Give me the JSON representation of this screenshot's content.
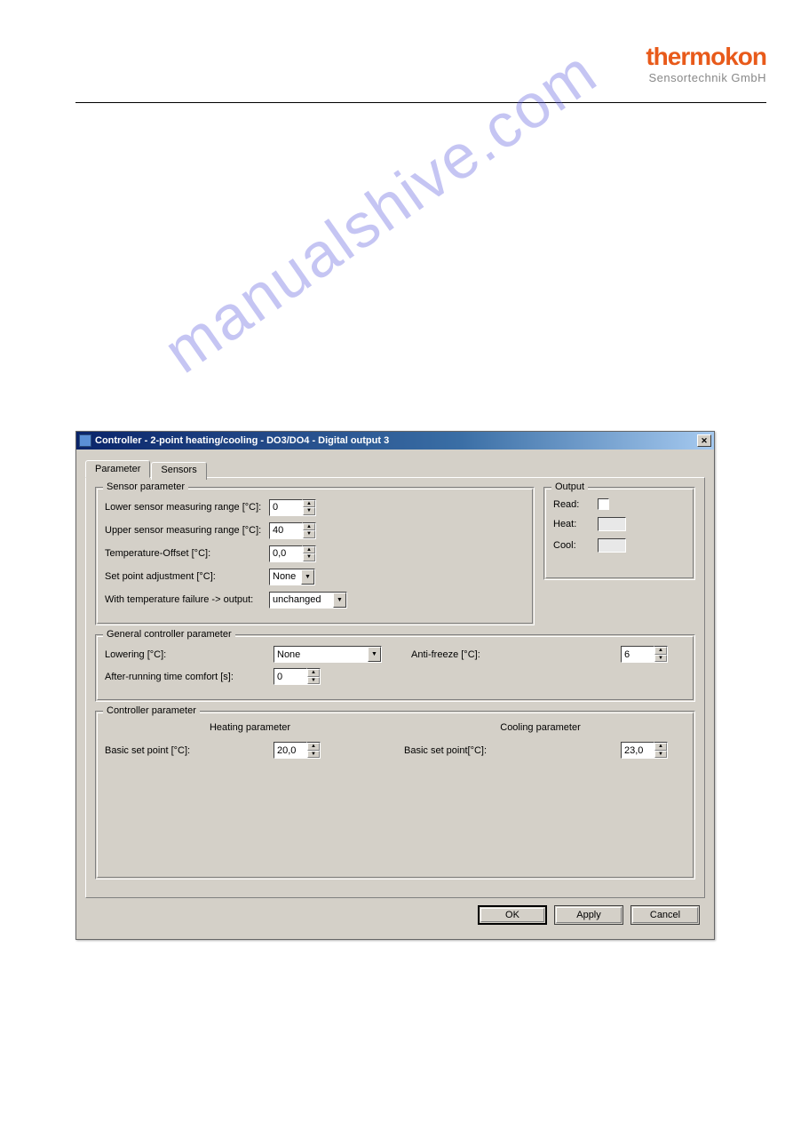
{
  "logo": {
    "line1": "thermokon",
    "line2": "Sensortechnik GmbH"
  },
  "watermark": "manualshive.com",
  "window": {
    "title": "Controller - 2-point heating/cooling - DO3/DO4 - Digital output 3"
  },
  "tabs": {
    "parameter": "Parameter",
    "sensors": "Sensors"
  },
  "sensorParameter": {
    "legend": "Sensor parameter",
    "lowerLabel": "Lower sensor measuring range [°C]:",
    "lowerValue": "0",
    "upperLabel": "Upper sensor measuring range [°C]:",
    "upperValue": "40",
    "offsetLabel": "Temperature-Offset [°C]:",
    "offsetValue": "0,0",
    "setpointLabel": "Set point adjustment [°C]:",
    "setpointValue": "None",
    "failureLabel": "With temperature failure -> output:",
    "failureValue": "unchanged"
  },
  "output": {
    "legend": "Output",
    "readLabel": "Read:",
    "heatLabel": "Heat:",
    "coolLabel": "Cool:"
  },
  "generalController": {
    "legend": "General controller parameter",
    "loweringLabel": "Lowering [°C]:",
    "loweringValue": "None",
    "antifreezeLabel": "Anti-freeze [°C]:",
    "antifreezeValue": "6",
    "afterRunLabel": "After-running time comfort [s]:",
    "afterRunValue": "0"
  },
  "controllerParameter": {
    "legend": "Controller parameter",
    "heatingHeader": "Heating parameter",
    "coolingHeader": "Cooling parameter",
    "heatSetpointLabel": "Basic set point [°C]:",
    "heatSetpointValue": "20,0",
    "coolSetpointLabel": "Basic set point[°C]:",
    "coolSetpointValue": "23,0"
  },
  "buttons": {
    "ok": "OK",
    "apply": "Apply",
    "cancel": "Cancel"
  }
}
